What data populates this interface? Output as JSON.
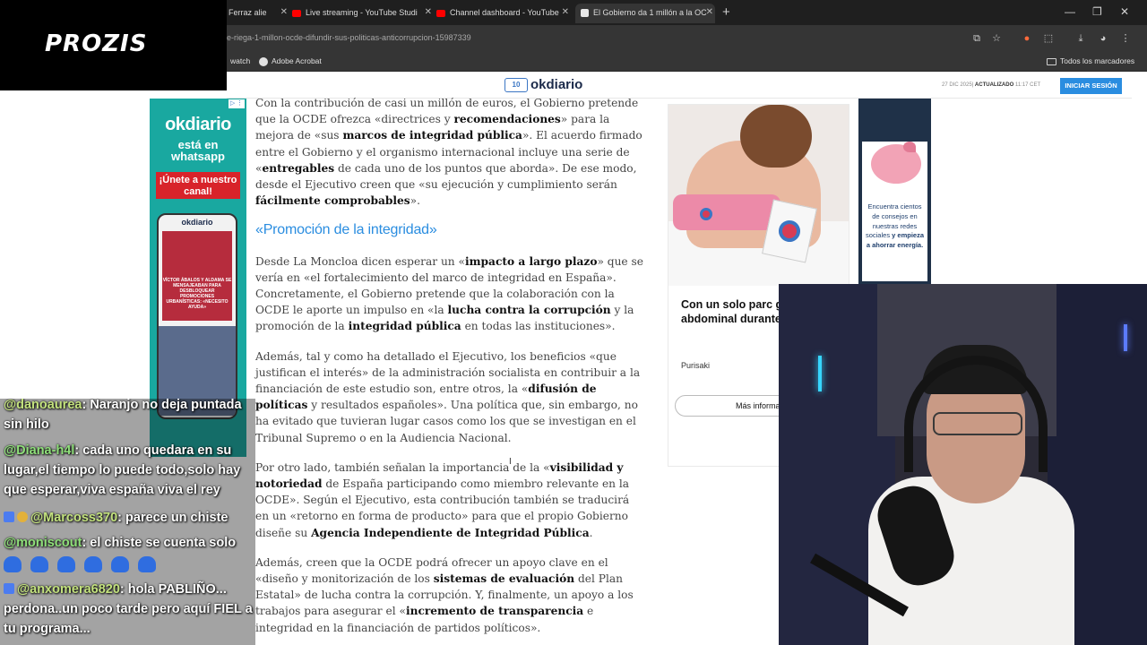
{
  "browser": {
    "tabs": [
      {
        "label": "Ferraz alie"
      },
      {
        "label": "Live streaming - YouTube Studi"
      },
      {
        "label": "Channel dashboard - YouTube"
      },
      {
        "label": "El Gobierno da 1 millón a la OC"
      }
    ],
    "url": "e-riega-1-millon-ocde-difundir-sus-politicas-anticorrupcion-15987339",
    "bookmarks": [
      {
        "label": "watch"
      },
      {
        "label": "Adobe Acrobat"
      }
    ],
    "all_bookmarks_label": "Todos los marcadores"
  },
  "site": {
    "logo_text": "okdiario",
    "date_label": "27 DIC 2025|",
    "updated_label": "ACTUALIZADO",
    "updated_time": "11:17",
    "timezone": "CET",
    "login_button": "INICIAR SESIÓN"
  },
  "article": {
    "p1": [
      {
        "t": "Con la contribución de casi un millón de euros, el Gobierno pretende que la OCDE ofrezca «directrices y ",
        "b": false
      },
      {
        "t": "recomendaciones",
        "b": true
      },
      {
        "t": "» para la mejora de «sus ",
        "b": false
      },
      {
        "t": "marcos de integridad pública",
        "b": true
      },
      {
        "t": "». El acuerdo firmado entre el Gobierno y el organismo internacional incluye una serie de «",
        "b": false
      },
      {
        "t": "entregables",
        "b": true
      },
      {
        "t": " de cada uno de los puntos que aborda». De ese modo, desde el Ejecutivo creen que «su ejecución y cumplimiento serán ",
        "b": false
      },
      {
        "t": "fácilmente comprobables",
        "b": true
      },
      {
        "t": "».",
        "b": false
      }
    ],
    "heading": "«Promoción de la integridad»",
    "p2": [
      {
        "t": "Desde La Moncloa dicen esperar un «",
        "b": false
      },
      {
        "t": "impacto a largo plazo",
        "b": true
      },
      {
        "t": "» que se vería en «el fortalecimiento del marco de integridad en España». Concretamente, el Gobierno pretende que la colaboración con la OCDE le aporte un impulso en «la ",
        "b": false
      },
      {
        "t": "lucha contra la corrupción",
        "b": true
      },
      {
        "t": " y la promoción de la ",
        "b": false
      },
      {
        "t": "integridad pública",
        "b": true
      },
      {
        "t": " en todas las instituciones».",
        "b": false
      }
    ],
    "p3": [
      {
        "t": "Además, tal y como ha detallado el Ejecutivo, los beneficios «que justifican el interés» de la administración socialista en contribuir a la financiación de este estudio son, entre otros, la «",
        "b": false
      },
      {
        "t": "difusión de políticas",
        "b": true
      },
      {
        "t": " y resultados españoles». Una política que, sin embargo, no ha evitado que tuvieran lugar casos como los que se investigan en el Tribunal Supremo o en la Audiencia Nacional.",
        "b": false
      }
    ],
    "p4": [
      {
        "t": "Por otro lado, también señalan la importancia de la «",
        "b": false
      },
      {
        "t": "visibilidad y notoriedad",
        "b": true
      },
      {
        "t": " de España participando como miembro relevante en la OCDE». Según el Ejecutivo, esta contribución también se traducirá en un «retorno en forma de producto» para que el propio Gobierno diseñe su ",
        "b": false
      },
      {
        "t": "Agencia Independiente de Integridad Pública",
        "b": true
      },
      {
        "t": ".",
        "b": false
      }
    ],
    "p5": [
      {
        "t": "Además, creen que la OCDE podrá ofrecer un apoyo clave en el «diseño y monitorización de los ",
        "b": false
      },
      {
        "t": "sistemas de evaluación",
        "b": true
      },
      {
        "t": " del Plan Estatal» de lucha contra la corrupción. Y, finalmente, un apoyo a los trabajos para asegurar el «",
        "b": false
      },
      {
        "t": "incremento de transparencia",
        "b": true
      },
      {
        "t": " e integridad en la financiación de partidos políticos».",
        "b": false
      }
    ]
  },
  "ad_left": {
    "brand": "okdiario",
    "sub": "está en whatsapp",
    "cta": "¡Únete a nuestro canal!",
    "phone_logo": "okdiario",
    "phone_text": "VÍCTOR ÁBALOS Y ALDAMA SE MENSAJEABAN PARA DESBLOQUEAR PROMOCIONES URBANÍSTICAS: «NECESITO AYUDA»"
  },
  "ad_mid": {
    "headline": "Con un solo parc grasa abdominal durante toda la n",
    "advertiser": "Purisaki",
    "button": "Más informac"
  },
  "ad_right": {
    "text_plain": "Encuentra cientos de consejos en nuestras redes sociales",
    "text_bold": "y empieza a ahorrar energía."
  },
  "chat": [
    {
      "user": "@danoaurea",
      "text": ": Naranjo no deja puntada sin hilo"
    },
    {
      "user": "@Diana-h4l",
      "text": ": cada uno quedara en su lugar,el tiempo lo puede todo,solo hay que esperar,viva españa viva el rey"
    },
    {
      "user": "@Marcoss370",
      "text": ": parece un chiste"
    },
    {
      "user": "@moniscout",
      "text": ": el chiste se cuenta solo"
    },
    {
      "user": "@anxomera6820",
      "text": ": hola PABLIÑO... perdona..un poco tarde pero aquí FIEL a tu programa..."
    }
  ],
  "overlay": {
    "sponsor": "PROZIS"
  },
  "colors": {
    "accent": "#2a8de0",
    "chrome_dark": "#1f1f1f",
    "chat_user": "#8fe07a",
    "ad_teal": "#19a8a0"
  }
}
